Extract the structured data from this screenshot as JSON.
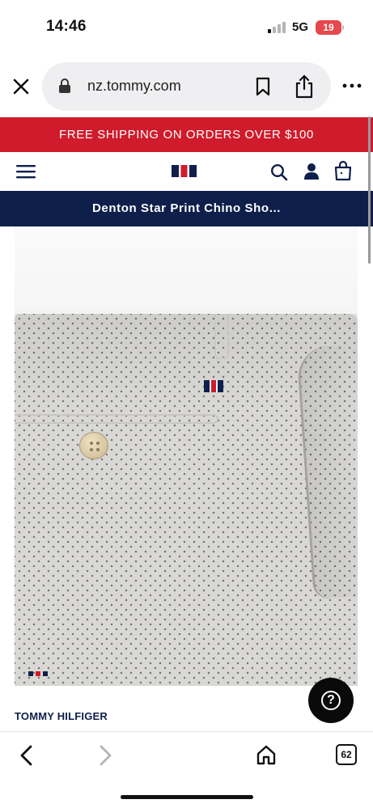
{
  "status_bar": {
    "time": "14:46",
    "network": "5G",
    "battery": "19",
    "battery_color": "#e5484d"
  },
  "browser": {
    "url": "nz.tommy.com",
    "close_icon": "close-icon",
    "lock_icon": "lock-icon",
    "bookmark_icon": "bookmark-icon",
    "share_icon": "share-icon",
    "more_icon": "more-icon",
    "toolbar": {
      "back_icon": "chevron-left-icon",
      "forward_icon": "chevron-right-icon",
      "home_icon": "home-icon",
      "tabs_count": "62"
    }
  },
  "site": {
    "promo": "FREE SHIPPING ON ORDERS OVER $100",
    "promo_color": "#cf1b2b",
    "navy_color": "#0f1f4b",
    "nav_icons": [
      "menu-icon",
      "tommy-flag-logo",
      "search-icon",
      "account-icon",
      "shopping-bag-icon"
    ],
    "product_title": "Denton Star Print Chino Sho...",
    "brand": "TOMMY HILFIGER",
    "help_icon": "help-icon"
  }
}
